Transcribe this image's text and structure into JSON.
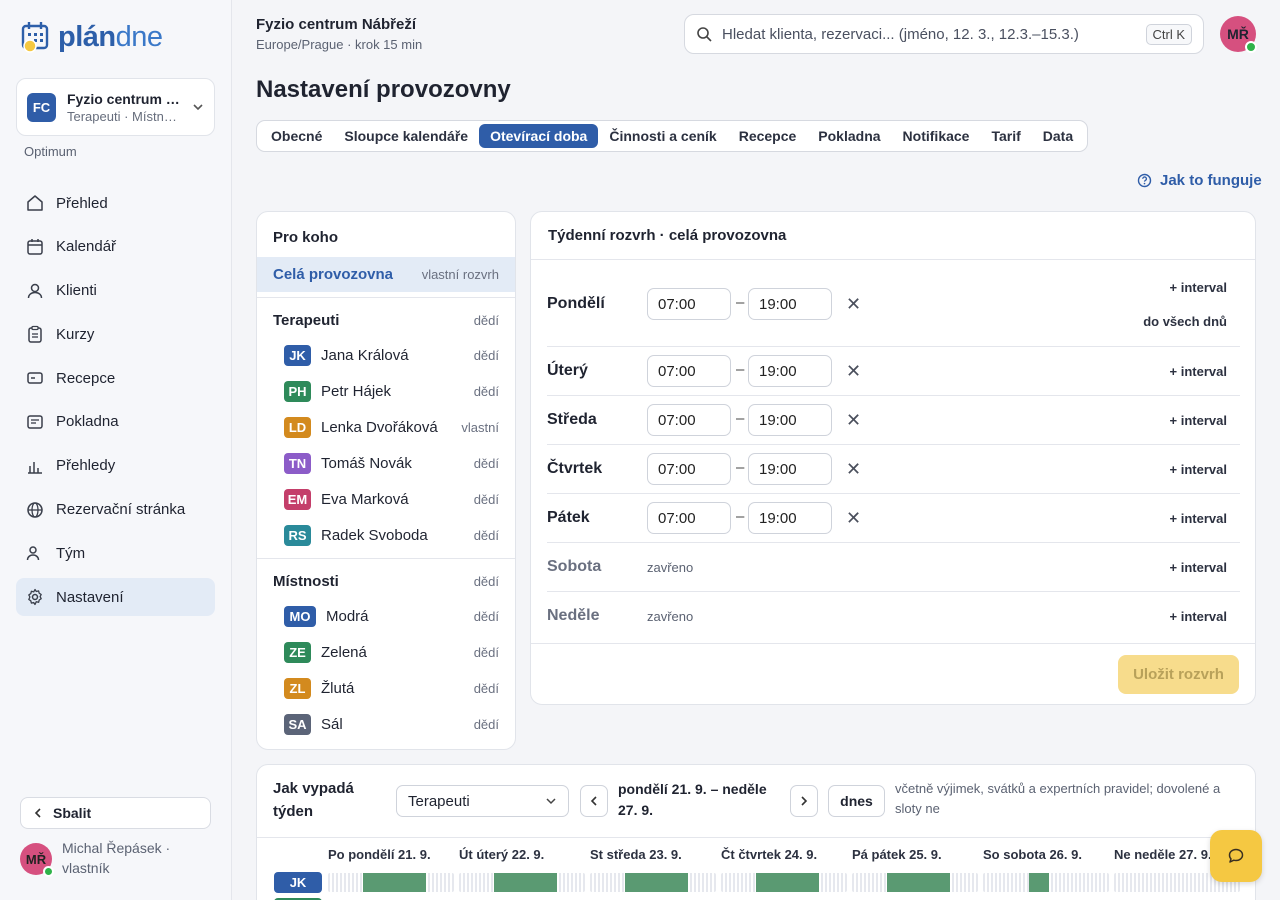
{
  "brand": {
    "name_bold": "plán",
    "name_light": "dne"
  },
  "org": {
    "initials": "FC",
    "name": "Fyzio centrum …",
    "sub": "Terapeuti · Místn…",
    "plan": "Optimum"
  },
  "nav": [
    {
      "label": "Přehled",
      "icon": "home-icon"
    },
    {
      "label": "Kalendář",
      "icon": "calendar-icon"
    },
    {
      "label": "Klienti",
      "icon": "user-icon"
    },
    {
      "label": "Kurzy",
      "icon": "clipboard-icon"
    },
    {
      "label": "Recepce",
      "icon": "reception-icon"
    },
    {
      "label": "Pokladna",
      "icon": "register-icon"
    },
    {
      "label": "Přehledy",
      "icon": "bar-chart-icon"
    },
    {
      "label": "Rezervační stránka",
      "icon": "globe-icon"
    },
    {
      "label": "Tým",
      "icon": "team-icon"
    },
    {
      "label": "Nastavení",
      "icon": "gear-icon",
      "active": true
    }
  ],
  "sidebar_footer": {
    "collapse": "Sbalit",
    "user_initials": "MŘ",
    "user_name": "Michal Řepásek · vlastník"
  },
  "topbar": {
    "title": "Fyzio centrum Nábřeží",
    "subtitle": "Europe/Prague · krok 15 min",
    "search_placeholder": "Hledat klienta, rezervaci... (jméno, 12. 3., 12.3.–15.3.)",
    "shortcut": "Ctrl K",
    "avatar": "MŘ"
  },
  "page": {
    "title": "Nastavení provozovny",
    "help": "Jak to funguje"
  },
  "tabs": [
    "Obecné",
    "Sloupce kalendáře",
    "Otevírací doba",
    "Činnosti a ceník",
    "Recepce",
    "Pokladna",
    "Notifikace",
    "Tarif",
    "Data"
  ],
  "active_tab": 2,
  "who": {
    "title": "Pro koho",
    "selected": {
      "label": "Celá provozovna",
      "status": "vlastní rozvrh"
    },
    "therapists_group": {
      "label": "Terapeuti",
      "status": "dědí"
    },
    "therapists": [
      {
        "initials": "JK",
        "name": "Jana Králová",
        "status": "dědí",
        "color": "#2f5da8"
      },
      {
        "initials": "PH",
        "name": "Petr Hájek",
        "status": "dědí",
        "color": "#2e8a5a"
      },
      {
        "initials": "LD",
        "name": "Lenka Dvořáková",
        "status": "vlastní",
        "color": "#d38a1e"
      },
      {
        "initials": "TN",
        "name": "Tomáš Novák",
        "status": "dědí",
        "color": "#8c5cc8"
      },
      {
        "initials": "EM",
        "name": "Eva Marková",
        "status": "dědí",
        "color": "#c43e6a"
      },
      {
        "initials": "RS",
        "name": "Radek Svoboda",
        "status": "dědí",
        "color": "#2a8a9a"
      }
    ],
    "rooms_group": {
      "label": "Místnosti",
      "status": "dědí"
    },
    "rooms": [
      {
        "initials": "MO",
        "name": "Modrá",
        "status": "dědí",
        "color": "#2f5da8"
      },
      {
        "initials": "ZE",
        "name": "Zelená",
        "status": "dědí",
        "color": "#2e8a5a"
      },
      {
        "initials": "ZL",
        "name": "Žlutá",
        "status": "dědí",
        "color": "#d38a1e"
      },
      {
        "initials": "SA",
        "name": "Sál",
        "status": "dědí",
        "color": "#5b6478"
      }
    ]
  },
  "schedule": {
    "title": "Týdenní rozvrh · celá provozovna",
    "add_interval": "+ interval",
    "copy_all": "do všech dnů",
    "closed_label": "zavřeno",
    "save": "Uložit rozvrh",
    "days": [
      {
        "name": "Pondělí",
        "from": "07:00",
        "to": "19:00",
        "open": true
      },
      {
        "name": "Úterý",
        "from": "07:00",
        "to": "19:00",
        "open": true
      },
      {
        "name": "Středa",
        "from": "07:00",
        "to": "19:00",
        "open": true
      },
      {
        "name": "Čtvrtek",
        "from": "07:00",
        "to": "19:00",
        "open": true
      },
      {
        "name": "Pátek",
        "from": "07:00",
        "to": "19:00",
        "open": true
      },
      {
        "name": "Sobota",
        "open": false
      },
      {
        "name": "Neděle",
        "open": false
      }
    ]
  },
  "week": {
    "title": "Jak vypadá týden",
    "filter": "Terapeuti",
    "range": "pondělí 21. 9. – neděle 27. 9.",
    "today": "dnes",
    "note": "včetně výjimek, svátků a expertních pravidel; dovolené a sloty ne",
    "days": [
      "Po pondělí 21. 9.",
      "Út úterý 22. 9.",
      "St středa 23. 9.",
      "Čt čtvrtek 24. 9.",
      "Pá pátek 25. 9.",
      "So sobota 26. 9.",
      "Ne neděle 27. 9."
    ],
    "row_badge": "JK"
  }
}
